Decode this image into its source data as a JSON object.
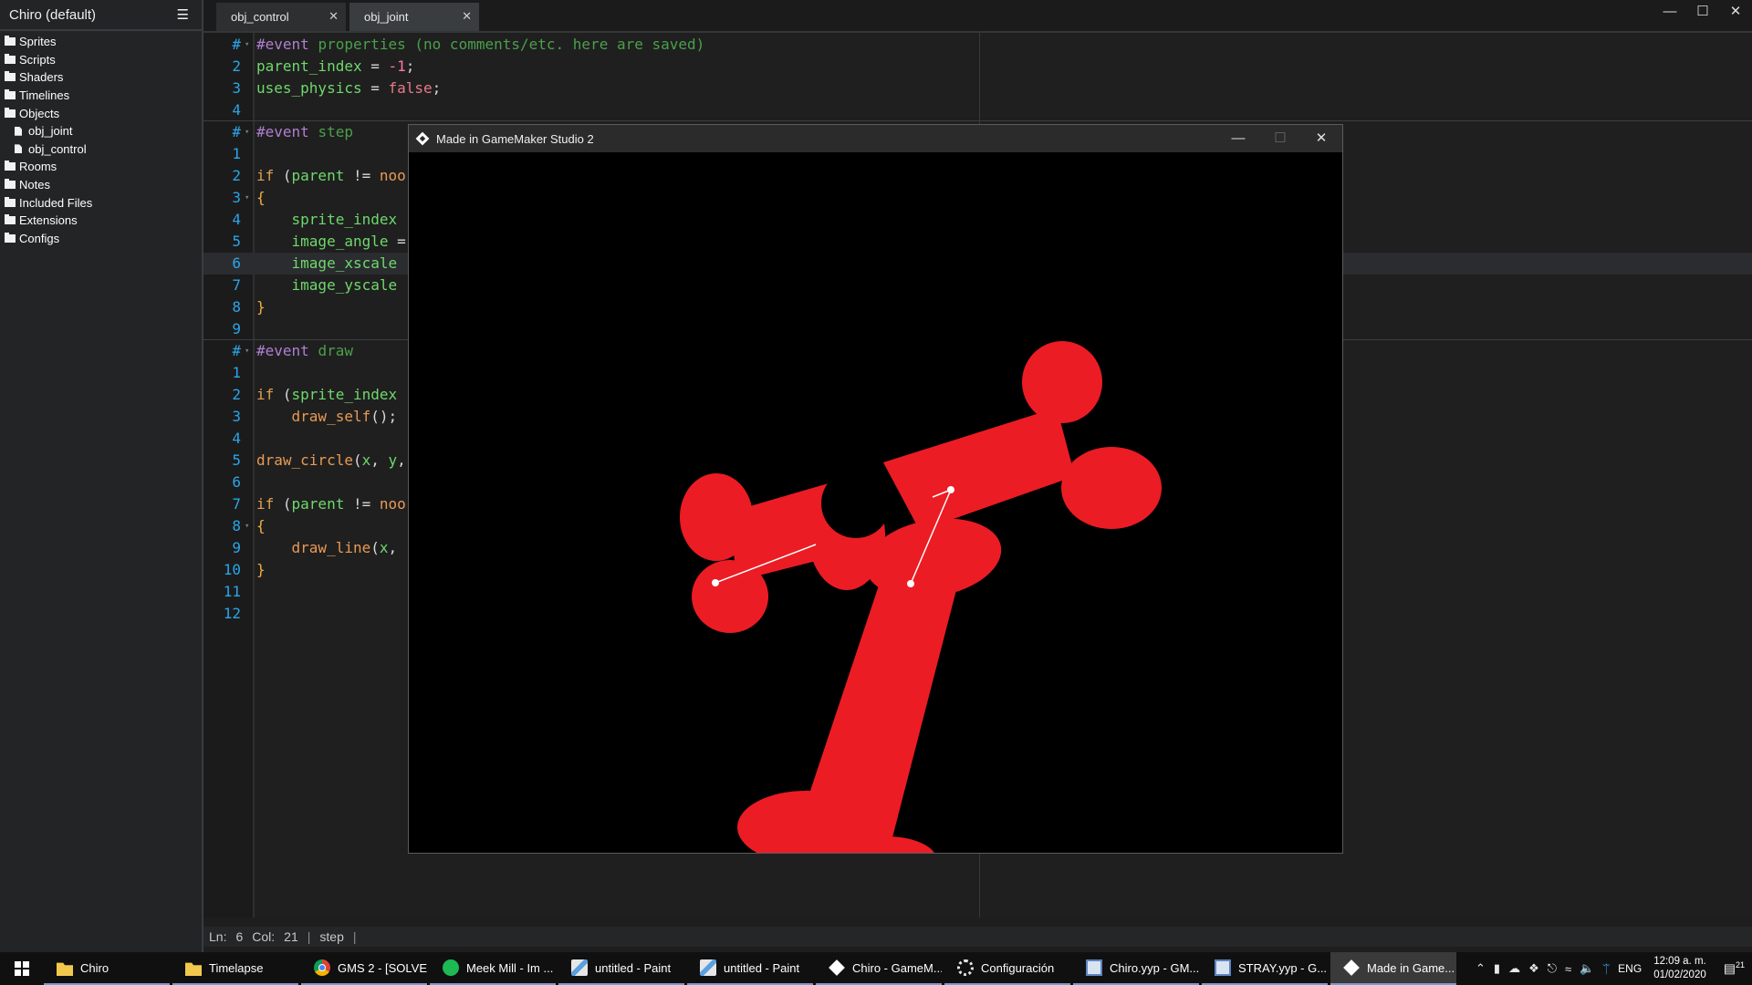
{
  "sidebar": {
    "title": "Chiro (default)",
    "items": [
      {
        "label": "Sprites",
        "kind": "folder",
        "depth": 0,
        "name": "sidebar-item-sprites"
      },
      {
        "label": "Scripts",
        "kind": "folder",
        "depth": 0,
        "name": "sidebar-item-scripts"
      },
      {
        "label": "Shaders",
        "kind": "folder",
        "depth": 0,
        "name": "sidebar-item-shaders"
      },
      {
        "label": "Timelines",
        "kind": "folder",
        "depth": 0,
        "name": "sidebar-item-timelines"
      },
      {
        "label": "Objects",
        "kind": "folder",
        "depth": 0,
        "name": "sidebar-item-objects"
      },
      {
        "label": "obj_joint",
        "kind": "file",
        "depth": 1,
        "name": "sidebar-item-obj-joint"
      },
      {
        "label": "obj_control",
        "kind": "file",
        "depth": 1,
        "name": "sidebar-item-obj-control"
      },
      {
        "label": "Rooms",
        "kind": "folder",
        "depth": 0,
        "name": "sidebar-item-rooms"
      },
      {
        "label": "Notes",
        "kind": "folder",
        "depth": 0,
        "name": "sidebar-item-notes"
      },
      {
        "label": "Included Files",
        "kind": "folder",
        "depth": 0,
        "name": "sidebar-item-included-files"
      },
      {
        "label": "Extensions",
        "kind": "folder",
        "depth": 0,
        "name": "sidebar-item-extensions"
      },
      {
        "label": "Configs",
        "kind": "folder",
        "depth": 0,
        "name": "sidebar-item-configs"
      }
    ]
  },
  "tabs": [
    {
      "label": "obj_control",
      "active": false
    },
    {
      "label": "obj_joint",
      "active": true
    }
  ],
  "code_lines": [
    {
      "ln": "#",
      "fold": true,
      "tokens": [
        [
          "c-event",
          "#event "
        ],
        [
          "c-comment",
          "properties (no comments/etc. here are saved)"
        ]
      ]
    },
    {
      "ln": "2",
      "tokens": [
        [
          "c-var",
          "parent_index"
        ],
        [
          "c-plain",
          " = "
        ],
        [
          "c-num",
          "-1"
        ],
        [
          "c-plain",
          ";"
        ]
      ]
    },
    {
      "ln": "3",
      "tokens": [
        [
          "c-var",
          "uses_physics"
        ],
        [
          "c-plain",
          " = "
        ],
        [
          "c-kw",
          "false"
        ],
        [
          "c-plain",
          ";"
        ]
      ]
    },
    {
      "ln": "4",
      "tokens": []
    },
    {
      "ln": "#",
      "fold": true,
      "sep": true,
      "tokens": [
        [
          "c-event",
          "#event "
        ],
        [
          "c-comment",
          "step"
        ]
      ]
    },
    {
      "ln": "1",
      "tokens": []
    },
    {
      "ln": "2",
      "tokens": [
        [
          "c-ctrl",
          "if"
        ],
        [
          "c-plain",
          " ("
        ],
        [
          "c-var",
          "parent"
        ],
        [
          "c-plain",
          " != "
        ],
        [
          "c-fn",
          "noo"
        ]
      ]
    },
    {
      "ln": "3",
      "fold": true,
      "tokens": [
        [
          "c-brace",
          "{"
        ]
      ]
    },
    {
      "ln": "4",
      "tokens": [
        [
          "c-plain",
          "    "
        ],
        [
          "c-var",
          "sprite_index"
        ]
      ]
    },
    {
      "ln": "5",
      "tokens": [
        [
          "c-plain",
          "    "
        ],
        [
          "c-var",
          "image_angle"
        ],
        [
          "c-plain",
          " ="
        ]
      ]
    },
    {
      "ln": "6",
      "hl": true,
      "tokens": [
        [
          "c-plain",
          "    "
        ],
        [
          "c-var",
          "image_xscale"
        ]
      ]
    },
    {
      "ln": "7",
      "tokens": [
        [
          "c-plain",
          "    "
        ],
        [
          "c-var",
          "image_yscale"
        ]
      ]
    },
    {
      "ln": "8",
      "tokens": [
        [
          "c-brace",
          "}"
        ]
      ]
    },
    {
      "ln": "9",
      "tokens": []
    },
    {
      "ln": "#",
      "fold": true,
      "sep": true,
      "tokens": [
        [
          "c-event",
          "#event "
        ],
        [
          "c-comment",
          "draw"
        ]
      ]
    },
    {
      "ln": "1",
      "tokens": []
    },
    {
      "ln": "2",
      "tokens": [
        [
          "c-ctrl",
          "if"
        ],
        [
          "c-plain",
          " ("
        ],
        [
          "c-var",
          "sprite_index"
        ]
      ]
    },
    {
      "ln": "3",
      "tokens": [
        [
          "c-plain",
          "    "
        ],
        [
          "c-fn",
          "draw_self"
        ],
        [
          "c-plain",
          "();"
        ]
      ]
    },
    {
      "ln": "4",
      "tokens": []
    },
    {
      "ln": "5",
      "tokens": [
        [
          "c-fn",
          "draw_circle"
        ],
        [
          "c-plain",
          "("
        ],
        [
          "c-var",
          "x"
        ],
        [
          "c-plain",
          ", "
        ],
        [
          "c-var",
          "y"
        ],
        [
          "c-plain",
          ","
        ]
      ]
    },
    {
      "ln": "6",
      "tokens": []
    },
    {
      "ln": "7",
      "tokens": [
        [
          "c-ctrl",
          "if"
        ],
        [
          "c-plain",
          " ("
        ],
        [
          "c-var",
          "parent"
        ],
        [
          "c-plain",
          " != "
        ],
        [
          "c-fn",
          "noo"
        ]
      ]
    },
    {
      "ln": "8",
      "fold": true,
      "tokens": [
        [
          "c-brace",
          "{"
        ]
      ]
    },
    {
      "ln": "9",
      "tokens": [
        [
          "c-plain",
          "    "
        ],
        [
          "c-fn",
          "draw_line"
        ],
        [
          "c-plain",
          "("
        ],
        [
          "c-var",
          "x"
        ],
        [
          "c-plain",
          ","
        ]
      ]
    },
    {
      "ln": "10",
      "tokens": [
        [
          "c-brace",
          "}"
        ]
      ]
    },
    {
      "ln": "11",
      "tokens": []
    },
    {
      "ln": "12",
      "tokens": []
    }
  ],
  "statusbar": {
    "ln_label": "Ln:",
    "ln_value": "6",
    "col_label": "Col:",
    "col_value": "21",
    "event": "step"
  },
  "game_window": {
    "title": "Made in GameMaker Studio 2",
    "sprite_color": "#ec1c24",
    "background": "#000000"
  },
  "taskbar": {
    "items": [
      {
        "label": "Chiro",
        "icon": "folder-icon",
        "cls": "ti-folder",
        "active": false
      },
      {
        "label": "Timelapse",
        "icon": "folder-icon",
        "cls": "ti-folder",
        "active": false
      },
      {
        "label": "GMS 2 - [SOLVE...",
        "icon": "chrome-icon",
        "cls": "ti-chrome",
        "active": false
      },
      {
        "label": "Meek Mill - Im ...",
        "icon": "spotify-icon",
        "cls": "ti-spotify",
        "active": false
      },
      {
        "label": "untitled - Paint",
        "icon": "paint-icon",
        "cls": "ti-paint",
        "active": false
      },
      {
        "label": "untitled - Paint",
        "icon": "paint-icon",
        "cls": "ti-paint",
        "active": false
      },
      {
        "label": "Chiro - GameM...",
        "icon": "gamemaker-icon",
        "cls": "ti-gm",
        "active": false
      },
      {
        "label": "Configuración",
        "icon": "gear-icon",
        "cls": "ti-gear",
        "active": false
      },
      {
        "label": "Chiro.yyp - GM...",
        "icon": "yyp-file-icon",
        "cls": "ti-yyp",
        "active": false
      },
      {
        "label": "STRAY.yyp - G...",
        "icon": "yyp-file-icon",
        "cls": "ti-yyp",
        "active": false
      },
      {
        "label": "Made in Game...",
        "icon": "gamemaker-icon",
        "cls": "ti-gm",
        "active": true
      }
    ],
    "language": "ENG",
    "time": "12:09 a. m.",
    "date": "01/02/2020",
    "notifications": "21"
  }
}
